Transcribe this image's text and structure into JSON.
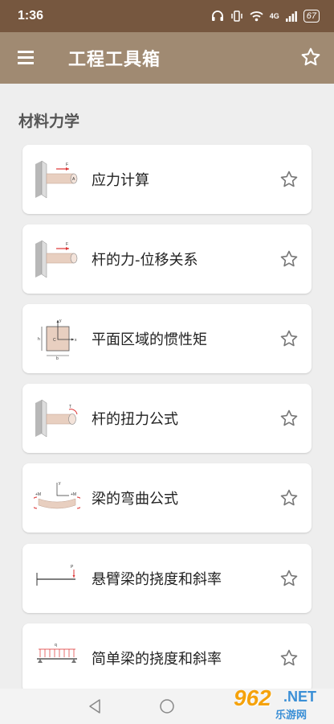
{
  "status": {
    "time": "1:36",
    "battery": "67",
    "network": "4G"
  },
  "appbar": {
    "title": "工程工具箱"
  },
  "section": {
    "title": "材料力学"
  },
  "items": [
    {
      "label": "应力计算",
      "icon": "cantilever-force-icon"
    },
    {
      "label": "杆的力-位移关系",
      "icon": "rod-force-displacement-icon"
    },
    {
      "label": "平面区域的惯性矩",
      "icon": "moment-of-inertia-icon"
    },
    {
      "label": "杆的扭力公式",
      "icon": "rod-torsion-icon"
    },
    {
      "label": "梁的弯曲公式",
      "icon": "beam-bending-icon"
    },
    {
      "label": "悬臂梁的挠度和斜率",
      "icon": "cantilever-deflection-icon"
    },
    {
      "label": "简单梁的挠度和斜率",
      "icon": "simple-beam-deflection-icon"
    }
  ],
  "watermark": {
    "number": "962",
    "suffix": ".NET",
    "text": "乐游网"
  },
  "colors": {
    "statusbar": "#76573f",
    "appbar": "#a08a72",
    "background": "#eeeeee",
    "card": "#ffffff"
  }
}
